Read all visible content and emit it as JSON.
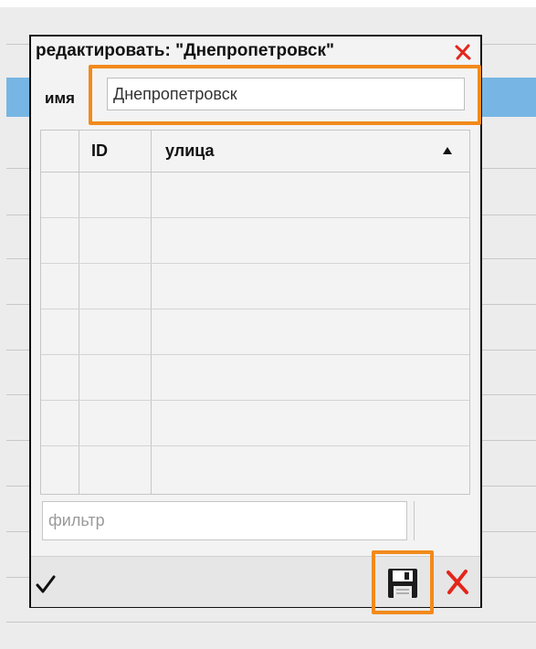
{
  "dialog": {
    "title": "редактировать: \"Днепропетровск\""
  },
  "form": {
    "name_label": "имя",
    "name_value": "Днепропетровск"
  },
  "table": {
    "columns": [
      "",
      "ID",
      "улица"
    ],
    "rows": []
  },
  "filter": {
    "placeholder": "фильтр",
    "value": ""
  },
  "icons": {
    "close": "close-x-icon",
    "sort": "sort-ascending-icon",
    "apply": "checkmark-icon",
    "save": "floppy-disk-icon",
    "delete": "delete-x-icon"
  },
  "colors": {
    "highlight_row": "#77b6e4",
    "focus_outline": "#f28a1c",
    "close_red": "#e3261b"
  }
}
